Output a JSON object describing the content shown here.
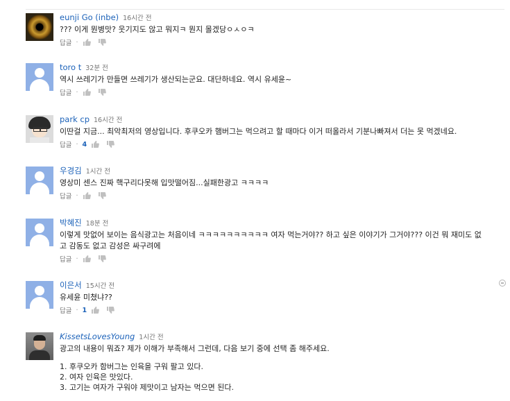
{
  "comments": [
    {
      "author": "eunji Go (inbe)",
      "time": "16시간 전",
      "lines": [
        "??? 이게 뭔병맛? 웃기지도 않고 뭐지ㅋ 뭔지 몰겠당ㅇㅅㅇㅋ"
      ],
      "reply_label": "답글",
      "likes": "",
      "avatar_icon": "eye-avatar-icon"
    },
    {
      "author": "toro t",
      "time": "32분 전",
      "lines": [
        "역시 쓰레기가 만들면 쓰레기가 생산되는군요. 대단하네요. 역시 유세윤~"
      ],
      "reply_label": "답글",
      "likes": "",
      "avatar_icon": "default-avatar-icon"
    },
    {
      "author": "park cp",
      "time": "16시간 전",
      "lines": [
        "이딴걸 지금... 최악최저의 영상입니다. 후쿠오카 햄버그는 먹으려고 할 때마다 이거 떠올라서 기분나빠져서 더는 못 먹겠네요."
      ],
      "reply_label": "답글",
      "likes": "4",
      "avatar_icon": "anime-avatar-icon"
    },
    {
      "author": "우경김",
      "time": "1시간 전",
      "lines": [
        "영상미 센스 진짜 핵구리다못해 입맛떨어짐...실패한광고 ㅋㅋㅋㅋ"
      ],
      "reply_label": "답글",
      "likes": "",
      "avatar_icon": "default-avatar-icon"
    },
    {
      "author": "박혜진",
      "time": "18분 전",
      "lines": [
        "이렇게 맛없어 보이는 음식광고는 처음이네 ㅋㅋㅋㅋㅋㅋㅋㅋㅋㅋ 여자 먹는거야?? 하고 싶은 이야기가 그거야??? 이건 뭐 재미도 없",
        "고 감동도 없고 감성은 싸구려에"
      ],
      "reply_label": "답글",
      "likes": "",
      "avatar_icon": "default-avatar-icon"
    },
    {
      "author": "이은서",
      "time": "15시간 전",
      "lines": [
        "유세윤 미쳤냐??"
      ],
      "reply_label": "답글",
      "likes": "1",
      "avatar_icon": "default-avatar-icon"
    },
    {
      "author": "KissetsLovesYoung",
      "time": "1시간 전",
      "lines": [
        "광고의 내용이 뭐죠? 제가 이해가 부족해서 그런데, 다음 보기 중에 선택 좀 해주세요.",
        "",
        "1. 후쿠오카 함버그는 인육을 구워 팔고 있다.",
        "2. 여자 인육은 맛있다.",
        "3. 고기는 여자가 구워야 제맛이고 남자는 먹으면 된다."
      ],
      "reply_label": "",
      "likes": "",
      "avatar_icon": "photo-avatar-icon"
    }
  ]
}
